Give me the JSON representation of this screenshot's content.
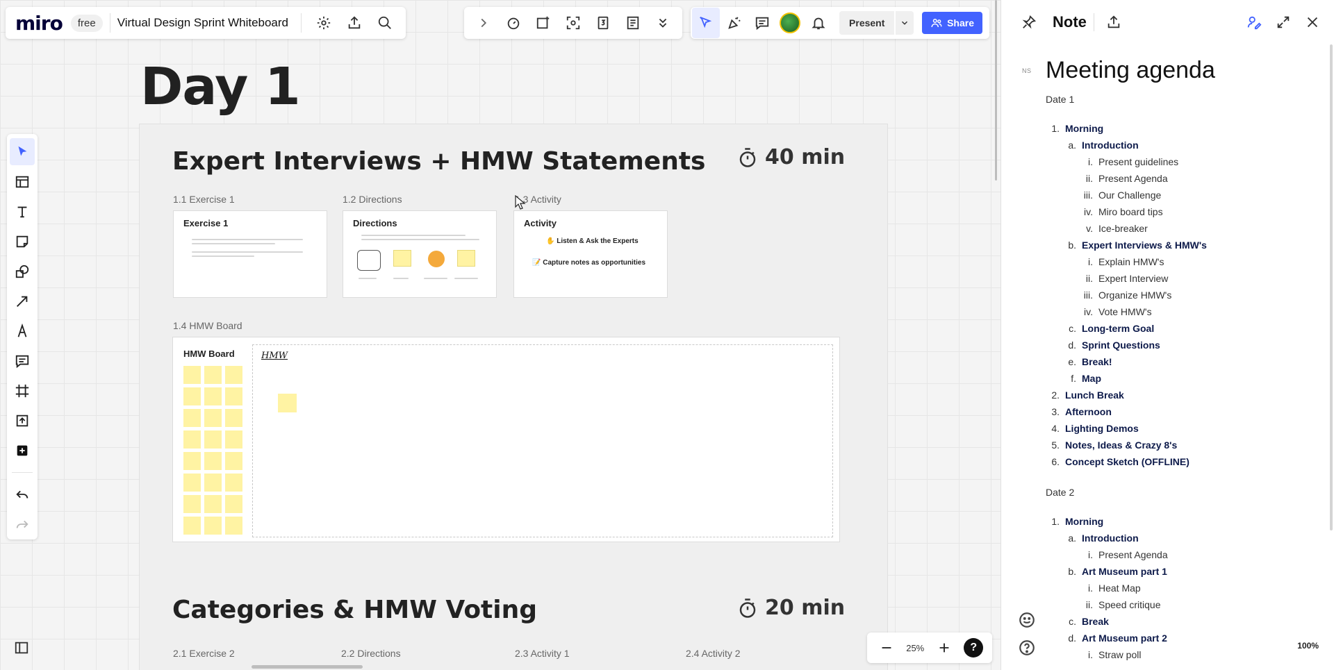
{
  "header": {
    "logo": "miro",
    "plan": "free",
    "board_title": "Virtual Design Sprint Whiteboard",
    "present_label": "Present",
    "share_label": "Share"
  },
  "canvas": {
    "day_title": "Day 1",
    "section1": {
      "title": "Expert Interviews + HMW Statements",
      "timer": "40 min",
      "frames": [
        {
          "label": "1.1 Exercise 1",
          "card_title": "Exercise 1"
        },
        {
          "label": "1.2 Directions",
          "card_title": "Directions"
        },
        {
          "label": "1.3 Activity",
          "card_title": "Activity"
        }
      ],
      "activity_lines": [
        "Listen & Ask the Experts",
        "Capture notes as opportunities"
      ],
      "hmw_label": "1.4 HMW Board",
      "hmw_title": "HMW Board",
      "hmw_scribble": "HMW"
    },
    "section2": {
      "title": "Categories & HMW Voting",
      "timer": "20 min",
      "frames": [
        "2.1 Exercise 2",
        "2.2 Directions",
        "2.3 Activity 1",
        "2.4 Activity 2"
      ]
    },
    "zoom": "25%",
    "help": "?"
  },
  "note": {
    "panel_title": "Note",
    "initials": "NS",
    "title": "Meeting agenda",
    "date1": "Date 1",
    "date2": "Date 2",
    "zoom": "100%",
    "day1": [
      {
        "m": "1.",
        "t": "Morning",
        "children": [
          {
            "m": "a.",
            "t": "Introduction",
            "children": [
              {
                "m": "i.",
                "t": "Present guidelines"
              },
              {
                "m": "ii.",
                "t": "Present Agenda"
              },
              {
                "m": "iii.",
                "t": "Our Challenge"
              },
              {
                "m": "iv.",
                "t": "Miro board tips"
              },
              {
                "m": "v.",
                "t": "Ice-breaker"
              }
            ]
          },
          {
            "m": "b.",
            "t": "Expert Interviews & HMW's",
            "children": [
              {
                "m": "i.",
                "t": "Explain HMW's"
              },
              {
                "m": "ii.",
                "t": "Expert Interview"
              },
              {
                "m": "iii.",
                "t": "Organize HMW's"
              },
              {
                "m": "iv.",
                "t": "Vote HMW's"
              }
            ]
          },
          {
            "m": "c.",
            "t": "Long-term Goal"
          },
          {
            "m": "d.",
            "t": "Sprint Questions"
          },
          {
            "m": "e.",
            "t": "Break!"
          },
          {
            "m": "f.",
            "t": "Map"
          }
        ]
      },
      {
        "m": "2.",
        "t": "Lunch Break"
      },
      {
        "m": "3.",
        "t": "Afternoon"
      },
      {
        "m": "4.",
        "t": "Lighting Demos"
      },
      {
        "m": "5.",
        "t": "Notes, Ideas & Crazy 8's"
      },
      {
        "m": "6.",
        "t": "Concept Sketch (OFFLINE)"
      }
    ],
    "day2": [
      {
        "m": "1.",
        "t": "Morning",
        "children": [
          {
            "m": "a.",
            "t": "Introduction",
            "children": [
              {
                "m": "i.",
                "t": "Present Agenda"
              }
            ]
          },
          {
            "m": "b.",
            "t": "Art Museum part 1",
            "children": [
              {
                "m": "i.",
                "t": "Heat Map"
              },
              {
                "m": "ii.",
                "t": "Speed critique"
              }
            ]
          },
          {
            "m": "c.",
            "t": "Break"
          },
          {
            "m": "d.",
            "t": "Art Museum part 2",
            "children": [
              {
                "m": "i.",
                "t": "Straw poll"
              }
            ]
          }
        ]
      }
    ]
  },
  "colors": {
    "accent": "#4262ff",
    "sticky": "#fff3a3",
    "note_heading": "#0d1a4a"
  }
}
